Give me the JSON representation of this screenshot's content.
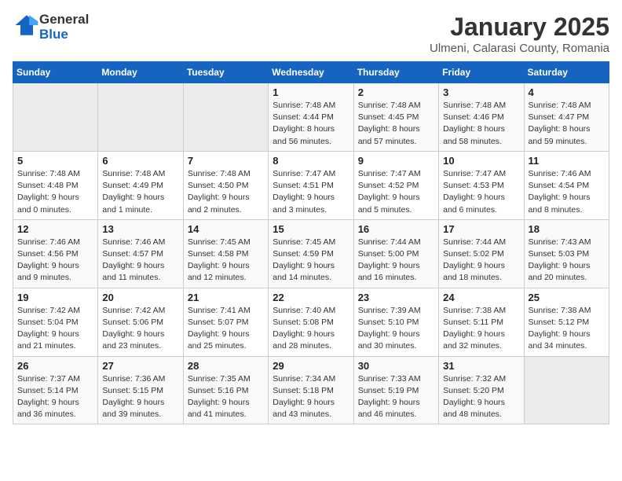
{
  "logo": {
    "general": "General",
    "blue": "Blue"
  },
  "header": {
    "title": "January 2025",
    "subtitle": "Ulmeni, Calarasi County, Romania"
  },
  "weekdays": [
    "Sunday",
    "Monday",
    "Tuesday",
    "Wednesday",
    "Thursday",
    "Friday",
    "Saturday"
  ],
  "weeks": [
    [
      {
        "day": "",
        "info": ""
      },
      {
        "day": "",
        "info": ""
      },
      {
        "day": "",
        "info": ""
      },
      {
        "day": "1",
        "info": "Sunrise: 7:48 AM\nSunset: 4:44 PM\nDaylight: 8 hours\nand 56 minutes."
      },
      {
        "day": "2",
        "info": "Sunrise: 7:48 AM\nSunset: 4:45 PM\nDaylight: 8 hours\nand 57 minutes."
      },
      {
        "day": "3",
        "info": "Sunrise: 7:48 AM\nSunset: 4:46 PM\nDaylight: 8 hours\nand 58 minutes."
      },
      {
        "day": "4",
        "info": "Sunrise: 7:48 AM\nSunset: 4:47 PM\nDaylight: 8 hours\nand 59 minutes."
      }
    ],
    [
      {
        "day": "5",
        "info": "Sunrise: 7:48 AM\nSunset: 4:48 PM\nDaylight: 9 hours\nand 0 minutes."
      },
      {
        "day": "6",
        "info": "Sunrise: 7:48 AM\nSunset: 4:49 PM\nDaylight: 9 hours\nand 1 minute."
      },
      {
        "day": "7",
        "info": "Sunrise: 7:48 AM\nSunset: 4:50 PM\nDaylight: 9 hours\nand 2 minutes."
      },
      {
        "day": "8",
        "info": "Sunrise: 7:47 AM\nSunset: 4:51 PM\nDaylight: 9 hours\nand 3 minutes."
      },
      {
        "day": "9",
        "info": "Sunrise: 7:47 AM\nSunset: 4:52 PM\nDaylight: 9 hours\nand 5 minutes."
      },
      {
        "day": "10",
        "info": "Sunrise: 7:47 AM\nSunset: 4:53 PM\nDaylight: 9 hours\nand 6 minutes."
      },
      {
        "day": "11",
        "info": "Sunrise: 7:46 AM\nSunset: 4:54 PM\nDaylight: 9 hours\nand 8 minutes."
      }
    ],
    [
      {
        "day": "12",
        "info": "Sunrise: 7:46 AM\nSunset: 4:56 PM\nDaylight: 9 hours\nand 9 minutes."
      },
      {
        "day": "13",
        "info": "Sunrise: 7:46 AM\nSunset: 4:57 PM\nDaylight: 9 hours\nand 11 minutes."
      },
      {
        "day": "14",
        "info": "Sunrise: 7:45 AM\nSunset: 4:58 PM\nDaylight: 9 hours\nand 12 minutes."
      },
      {
        "day": "15",
        "info": "Sunrise: 7:45 AM\nSunset: 4:59 PM\nDaylight: 9 hours\nand 14 minutes."
      },
      {
        "day": "16",
        "info": "Sunrise: 7:44 AM\nSunset: 5:00 PM\nDaylight: 9 hours\nand 16 minutes."
      },
      {
        "day": "17",
        "info": "Sunrise: 7:44 AM\nSunset: 5:02 PM\nDaylight: 9 hours\nand 18 minutes."
      },
      {
        "day": "18",
        "info": "Sunrise: 7:43 AM\nSunset: 5:03 PM\nDaylight: 9 hours\nand 20 minutes."
      }
    ],
    [
      {
        "day": "19",
        "info": "Sunrise: 7:42 AM\nSunset: 5:04 PM\nDaylight: 9 hours\nand 21 minutes."
      },
      {
        "day": "20",
        "info": "Sunrise: 7:42 AM\nSunset: 5:06 PM\nDaylight: 9 hours\nand 23 minutes."
      },
      {
        "day": "21",
        "info": "Sunrise: 7:41 AM\nSunset: 5:07 PM\nDaylight: 9 hours\nand 25 minutes."
      },
      {
        "day": "22",
        "info": "Sunrise: 7:40 AM\nSunset: 5:08 PM\nDaylight: 9 hours\nand 28 minutes."
      },
      {
        "day": "23",
        "info": "Sunrise: 7:39 AM\nSunset: 5:10 PM\nDaylight: 9 hours\nand 30 minutes."
      },
      {
        "day": "24",
        "info": "Sunrise: 7:38 AM\nSunset: 5:11 PM\nDaylight: 9 hours\nand 32 minutes."
      },
      {
        "day": "25",
        "info": "Sunrise: 7:38 AM\nSunset: 5:12 PM\nDaylight: 9 hours\nand 34 minutes."
      }
    ],
    [
      {
        "day": "26",
        "info": "Sunrise: 7:37 AM\nSunset: 5:14 PM\nDaylight: 9 hours\nand 36 minutes."
      },
      {
        "day": "27",
        "info": "Sunrise: 7:36 AM\nSunset: 5:15 PM\nDaylight: 9 hours\nand 39 minutes."
      },
      {
        "day": "28",
        "info": "Sunrise: 7:35 AM\nSunset: 5:16 PM\nDaylight: 9 hours\nand 41 minutes."
      },
      {
        "day": "29",
        "info": "Sunrise: 7:34 AM\nSunset: 5:18 PM\nDaylight: 9 hours\nand 43 minutes."
      },
      {
        "day": "30",
        "info": "Sunrise: 7:33 AM\nSunset: 5:19 PM\nDaylight: 9 hours\nand 46 minutes."
      },
      {
        "day": "31",
        "info": "Sunrise: 7:32 AM\nSunset: 5:20 PM\nDaylight: 9 hours\nand 48 minutes."
      },
      {
        "day": "",
        "info": ""
      }
    ]
  ]
}
